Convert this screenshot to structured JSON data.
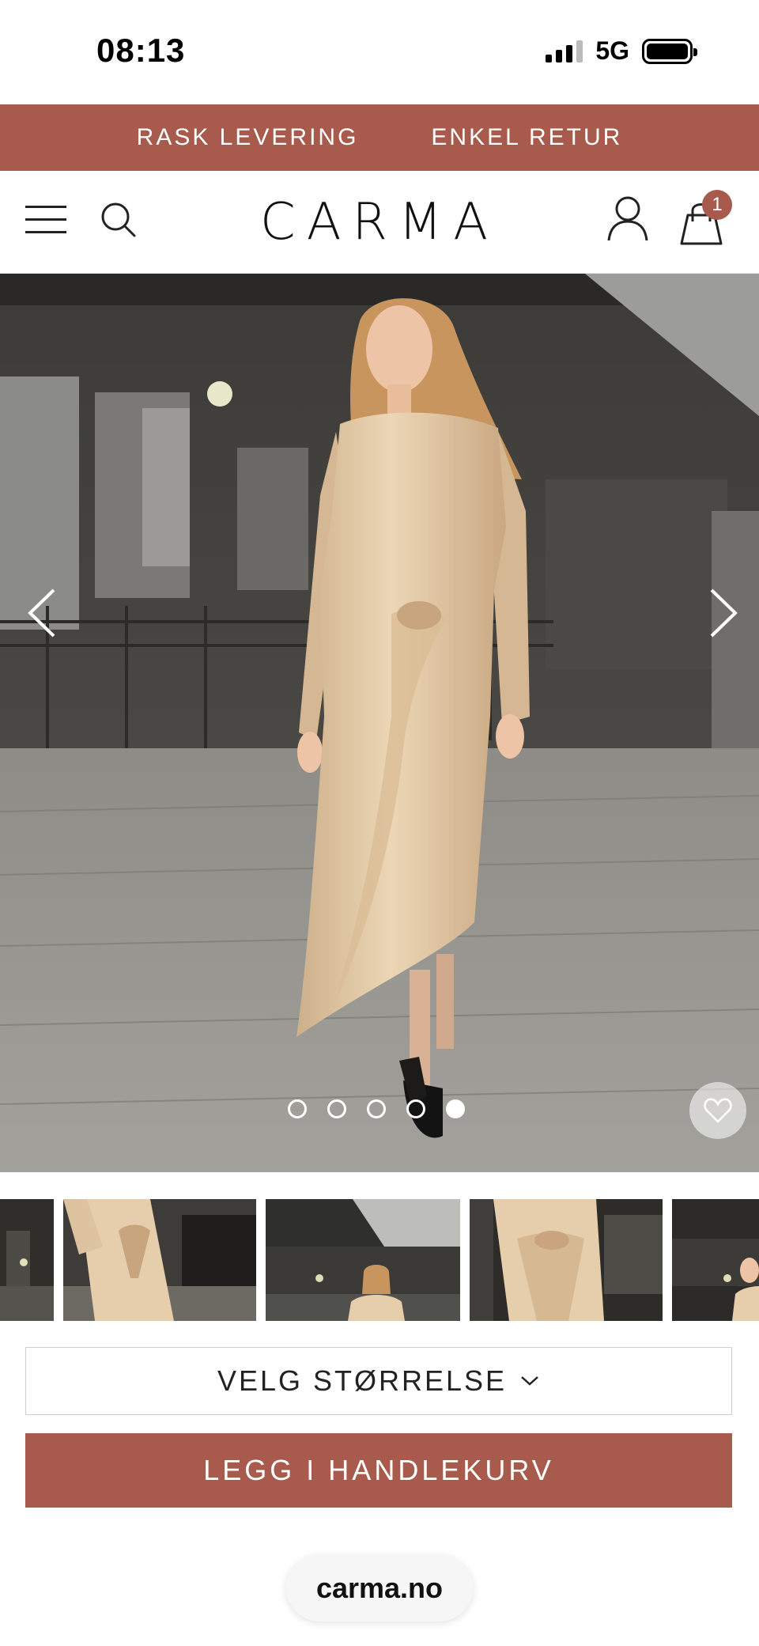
{
  "status_bar": {
    "time": "08:13",
    "network": "5G"
  },
  "promo_banner": {
    "items": [
      "RASK LEVERING",
      "ENKEL RETUR"
    ]
  },
  "header": {
    "logo": "CARMA",
    "cart_count": "1"
  },
  "gallery": {
    "slide_count": 5,
    "active_slide": 5
  },
  "product_actions": {
    "size_select_label": "VELG STØRRELSE",
    "add_to_cart_label": "LEGG I HANDLEKURV"
  },
  "browser": {
    "url": "carma.no"
  },
  "colors": {
    "accent": "#a85a4d",
    "dress": "#e3c9a5"
  }
}
